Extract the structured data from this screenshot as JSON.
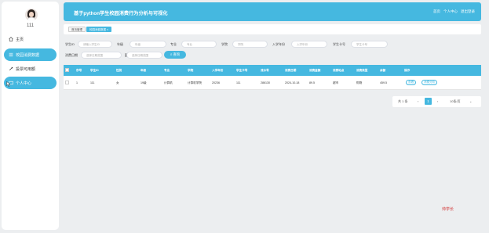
{
  "user": {
    "name": "111"
  },
  "sidebar": {
    "items": [
      {
        "label": "主页",
        "icon": "home-icon"
      },
      {
        "label": "校园消费数据",
        "icon": "list-icon"
      },
      {
        "label": "投票可用额",
        "icon": "vote-icon"
      },
      {
        "label": "个人中心",
        "icon": "user-icon"
      }
    ]
  },
  "header": {
    "title": "基于python学生校园消费行为分析与可视化",
    "links": [
      "首页",
      "个人中心",
      "退出登录"
    ]
  },
  "tabs": [
    {
      "label": "首页管理"
    },
    {
      "label": "校园消费数据 ×"
    }
  ],
  "search": {
    "fields": [
      {
        "label": "学生ID",
        "placeholder": "请输入学生ID"
      },
      {
        "label": "年级",
        "placeholder": "年级"
      },
      {
        "label": "专业",
        "placeholder": "专业"
      },
      {
        "label": "学院",
        "placeholder": "学院"
      },
      {
        "label": "入学年份",
        "placeholder": "入学年份"
      },
      {
        "label": "学生卡号",
        "placeholder": "学生卡号"
      }
    ],
    "date_label": "消费日期",
    "date_start_placeholder": "选择日期范围",
    "date_end_placeholder": "选择日期范围",
    "date_sep": "至",
    "button_label": "查询"
  },
  "table": {
    "headers": [
      "序号",
      "学生ID",
      "性别",
      "年级",
      "专业",
      "学院",
      "入学年份",
      "学生卡号",
      "流水号",
      "消费日期",
      "消费金额",
      "消费地点",
      "消费类型",
      "余额",
      "操作"
    ],
    "rows": [
      [
        "1",
        "111",
        "女",
        "19级",
        "计算机",
        "计算机学院",
        "20236",
        "111",
        "286130",
        "2024-10-18",
        "89.5",
        "超市",
        "购物",
        "459.5"
      ]
    ],
    "op_view": "查看",
    "op_analysis": "消费分析"
  },
  "pager": {
    "total": "共 1 条",
    "prev": "‹",
    "current": "1",
    "next": "›",
    "page_size": "10条/页"
  },
  "footer_tag": "帅学长",
  "colors": {
    "accent": "#45b8e0",
    "footer_tag": "#d23333"
  }
}
